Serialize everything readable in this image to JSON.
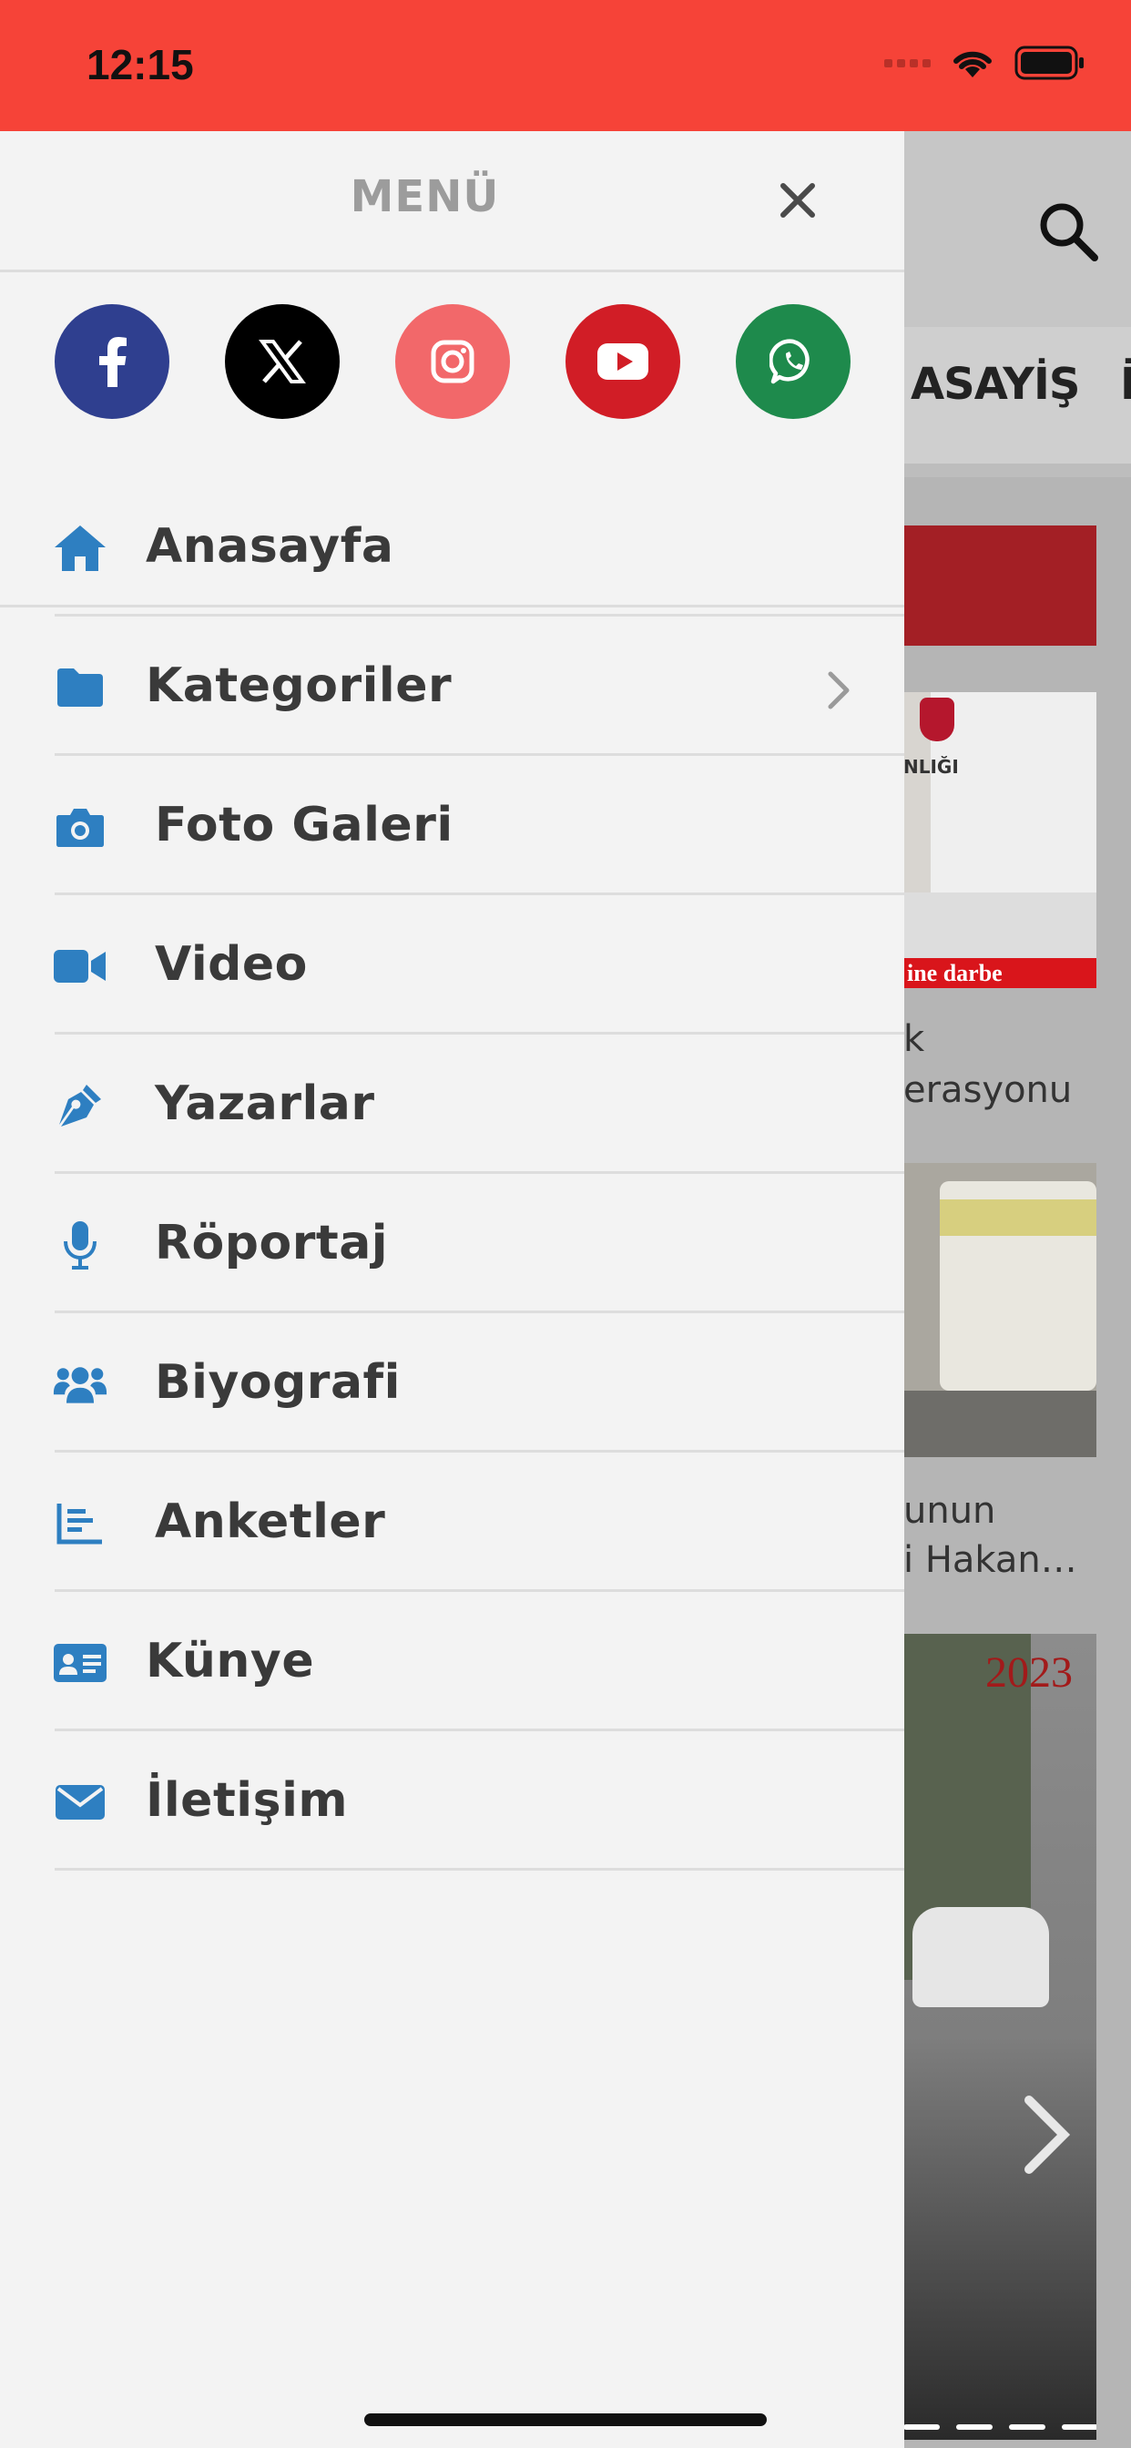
{
  "status_bar": {
    "time": "12:15",
    "icons": [
      "cellular-signal-icon",
      "wifi-icon",
      "battery-icon"
    ],
    "background": "#f64338"
  },
  "background_page": {
    "nav_items": [
      "ASAYİŞ",
      "İ"
    ],
    "card1": {
      "image_caption_overlay": "ine darbe",
      "sign_text": "NLIĞI",
      "title_lines": [
        "k",
        "erasyonu"
      ]
    },
    "card2": {
      "title_lines": [
        "unun",
        "i Hakan…"
      ]
    },
    "card3": {
      "year_overlay": "2023"
    },
    "accent": "#a31f25"
  },
  "drawer": {
    "title": "MENÜ",
    "close_icon": "close-icon",
    "social": [
      {
        "name": "facebook",
        "icon": "facebook-icon",
        "color": "#2f3f8f"
      },
      {
        "name": "x",
        "icon": "x-icon",
        "color": "#000000"
      },
      {
        "name": "instagram",
        "icon": "instagram-icon",
        "color": "#f2686a"
      },
      {
        "name": "youtube",
        "icon": "youtube-icon",
        "color": "#d11d26"
      },
      {
        "name": "whatsapp",
        "icon": "whatsapp-icon",
        "color": "#1e8a4c"
      }
    ],
    "items": [
      {
        "label": "Anasayfa",
        "icon": "home-icon"
      },
      {
        "label": "Kategoriler",
        "icon": "folder-icon",
        "has_chevron": true
      },
      {
        "label": "Foto Galeri",
        "icon": "camera-icon"
      },
      {
        "label": "Video",
        "icon": "video-camera-icon"
      },
      {
        "label": "Yazarlar",
        "icon": "pen-nib-icon"
      },
      {
        "label": "Röportaj",
        "icon": "microphone-icon"
      },
      {
        "label": "Biyografi",
        "icon": "users-icon"
      },
      {
        "label": "Anketler",
        "icon": "bar-chart-icon"
      },
      {
        "label": "Künye",
        "icon": "id-card-icon"
      },
      {
        "label": "İletişim",
        "icon": "envelope-icon"
      }
    ],
    "icon_color": "#2e7fc1"
  }
}
